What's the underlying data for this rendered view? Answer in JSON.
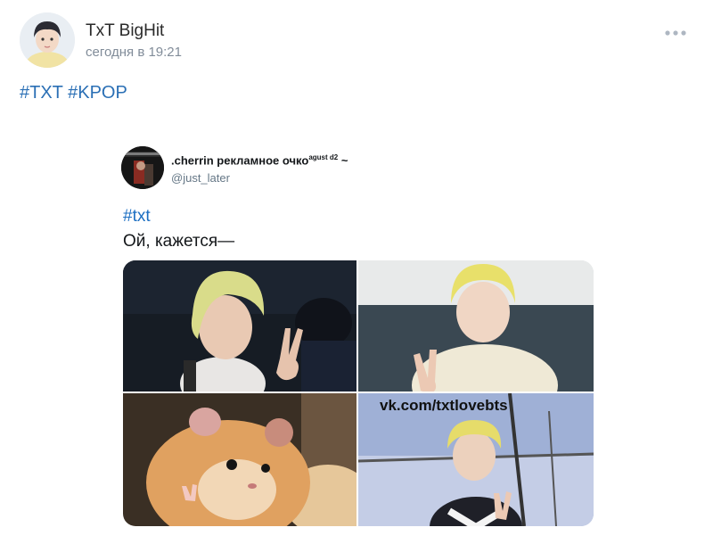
{
  "post": {
    "author": "TxT BigHit",
    "time": "сегодня в 19:21",
    "tags": [
      "#TXT",
      "#KPOP"
    ]
  },
  "tweet": {
    "name": ".cherrin рекламное очко",
    "name_sup": "agust d2",
    "name_tail": "~",
    "handle": "@just_later",
    "hashtag": "#txt",
    "text": "Ой, кажется—",
    "watermark": "vk.com/txtlovebts"
  },
  "colors": {
    "link": "#2a5885",
    "time": "#818c99",
    "hair_blond": "#e6dc6a"
  },
  "icons": {
    "more": "more-horizontal-icon"
  }
}
